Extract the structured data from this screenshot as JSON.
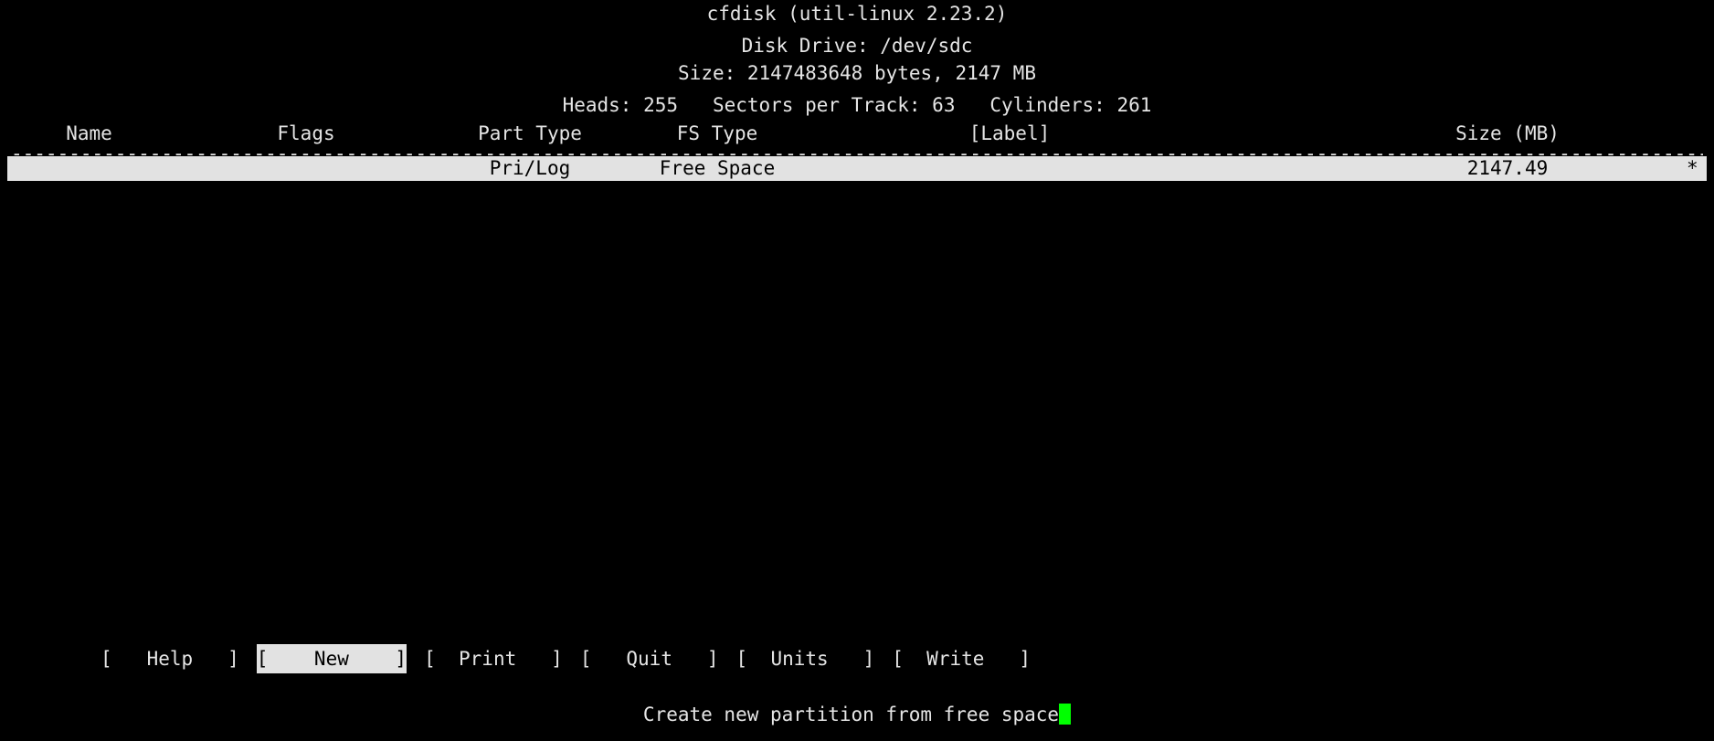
{
  "app": {
    "title": "cfdisk (util-linux 2.23.2)"
  },
  "disk_info": {
    "drive_line": "Disk Drive: /dev/sdc",
    "size_line": "Size: 2147483648 bytes, 2147 MB",
    "geometry_line": "Heads: 255   Sectors per Track: 63   Cylinders: 261",
    "heads_label": "Heads: 255",
    "sectors_label": "Sectors per Track: 63",
    "cylinders_label": "Cylinders: 261"
  },
  "table": {
    "columns": [
      {
        "key": "name",
        "label": "Name"
      },
      {
        "key": "flags",
        "label": "Flags"
      },
      {
        "key": "part_type",
        "label": "Part Type"
      },
      {
        "key": "fs_type",
        "label": "FS Type"
      },
      {
        "key": "label",
        "label": "[Label]"
      },
      {
        "key": "size_mb",
        "label": "Size (MB)"
      }
    ],
    "separator": "------------------------------------------------------------------------------------------------------------------------------------------------------------------------------------",
    "rows": [
      {
        "name": "",
        "flags": "",
        "part_type": "Pri/Log",
        "fs_type": "Free Space",
        "label": "",
        "size_mb": "2147.49",
        "marker": "*",
        "selected": true
      }
    ]
  },
  "buttons": [
    {
      "name": "help",
      "text": "[   Help   ]",
      "selected": false
    },
    {
      "name": "new",
      "text": "[    New    ]",
      "selected": true
    },
    {
      "name": "print",
      "text": "[  Print   ]",
      "selected": false
    },
    {
      "name": "quit",
      "text": "[   Quit   ]",
      "selected": false
    },
    {
      "name": "units",
      "text": "[  Units   ]",
      "selected": false
    },
    {
      "name": "write",
      "text": "[  Write   ]",
      "selected": false
    }
  ],
  "status": {
    "message": "Create new partition from free space"
  },
  "colors": {
    "background": "#000000",
    "foreground": "#e5e5e5",
    "highlight_bg": "#e2e2e2",
    "highlight_fg": "#000000",
    "cursor": "#00ff00"
  }
}
